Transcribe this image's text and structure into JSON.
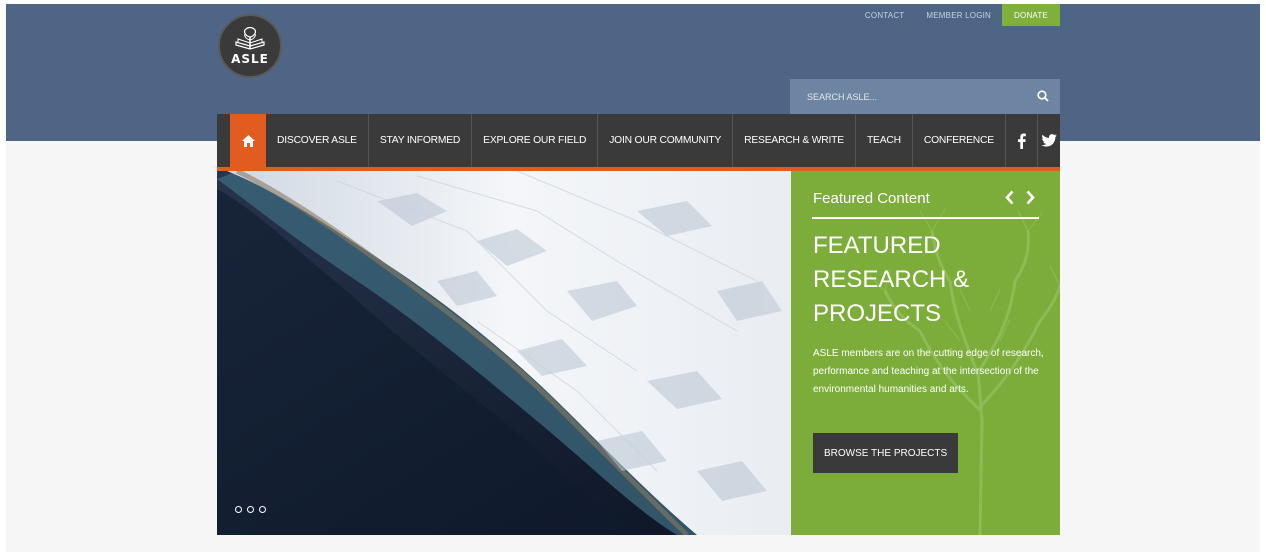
{
  "brand": {
    "logo_text": "ASLE"
  },
  "utility_nav": {
    "contact": "CONTACT",
    "member_login": "MEMBER LOGIN",
    "donate": "DONATE"
  },
  "search": {
    "placeholder": "SEARCH ASLE..."
  },
  "main_nav": {
    "items": [
      {
        "label": "DISCOVER ASLE"
      },
      {
        "label": "STAY INFORMED"
      },
      {
        "label": "EXPLORE OUR FIELD"
      },
      {
        "label": "JOIN OUR COMMUNITY"
      },
      {
        "label": "RESEARCH & WRITE"
      },
      {
        "label": "TEACH"
      },
      {
        "label": "CONFERENCE"
      }
    ]
  },
  "featured": {
    "label": "Featured Content",
    "title": "FEATURED RESEARCH & PROJECTS",
    "body": "ASLE members are on the cutting edge of research, performance and teaching at the intersection of the environmental humanities and arts.",
    "button": "BROWSE THE PROJECTS"
  },
  "slider": {
    "slide_count": 3
  },
  "colors": {
    "header": "#4e6585",
    "nav": "#3a3a3a",
    "accent_orange": "#e25b1f",
    "accent_green": "#7cad3a",
    "search": "#6e84a3"
  },
  "icons": [
    "home-icon",
    "search-icon",
    "facebook-icon",
    "twitter-icon",
    "chevron-left-icon",
    "chevron-right-icon"
  ]
}
